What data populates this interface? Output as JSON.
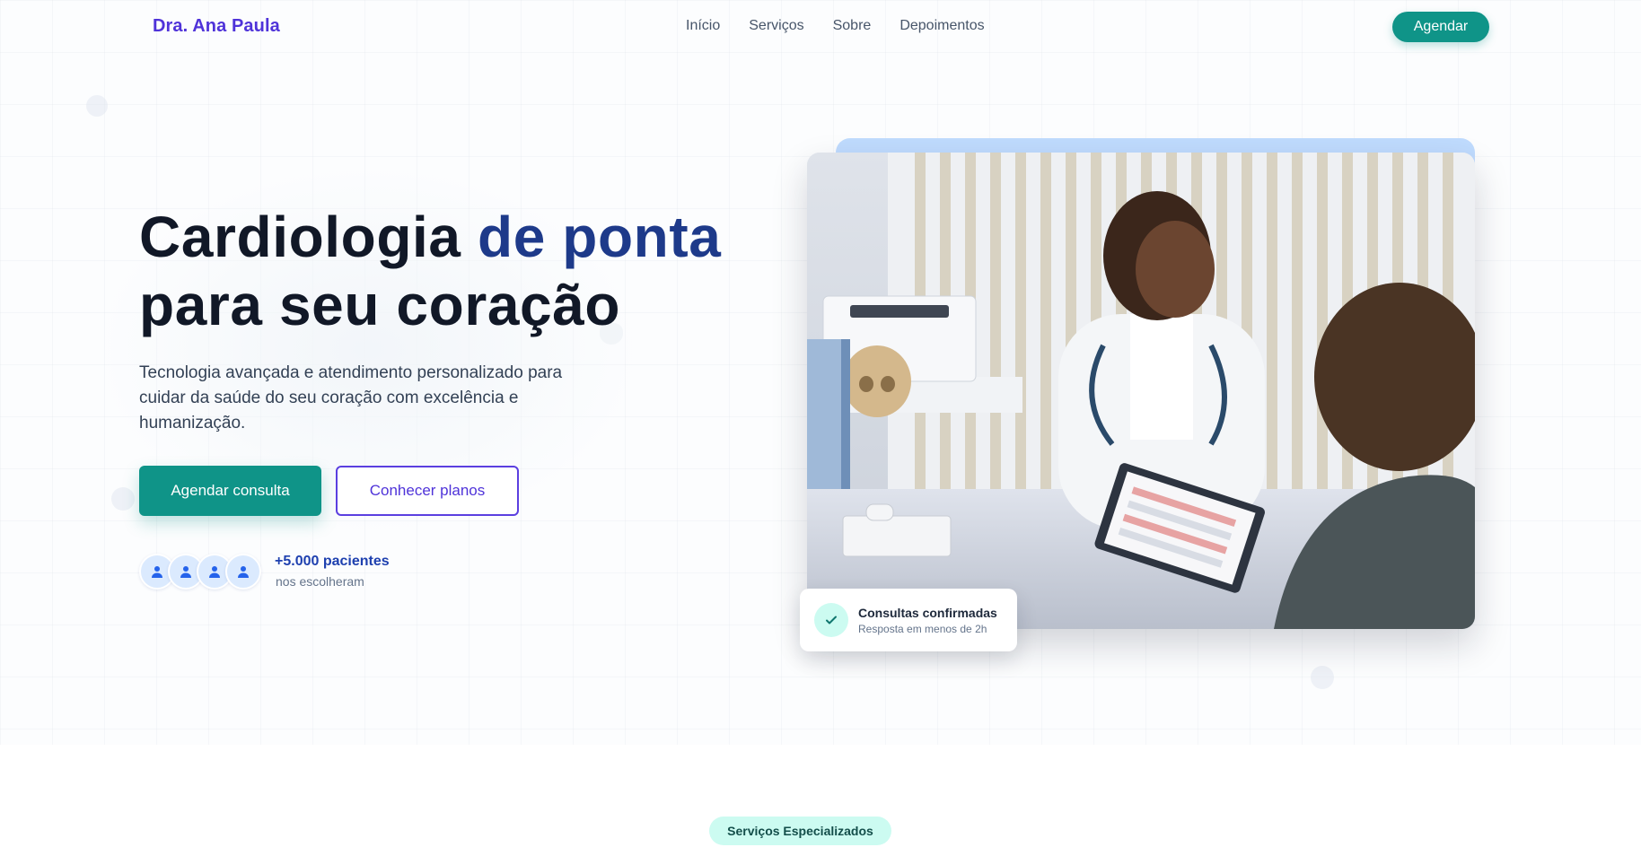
{
  "nav": {
    "brand": "Dra. Ana Paula",
    "links": [
      "Início",
      "Serviços",
      "Sobre",
      "Depoimentos"
    ],
    "cta": "Agendar"
  },
  "hero": {
    "title_line1_a": "Cardiologia",
    "title_line1_b": "de ponta",
    "title_line2": "para seu coração",
    "subtitle": "Tecnologia avançada e atendimento personalizado para cuidar da saúde do seu coração com excelência e humanização.",
    "primary_button": "Agendar consulta",
    "secondary_button": "Conhecer planos",
    "social_proof": {
      "count": "+5.000 pacientes",
      "label": "nos escolheram",
      "avatar_icon": "user-icon"
    }
  },
  "hero_image": {
    "status_card": {
      "title": "Consultas confirmadas",
      "subtitle": "Resposta em menos de 2h",
      "icon": "check-icon"
    }
  },
  "services": {
    "pill": "Serviços Especializados"
  },
  "colors": {
    "brand": "#4f33d9",
    "accent_teal": "#0f9488",
    "heading": "#111827",
    "heading_accent": "#1e3a8a",
    "image_backdrop": "#bfdbfe",
    "pill_bg": "#ccfbf1"
  }
}
